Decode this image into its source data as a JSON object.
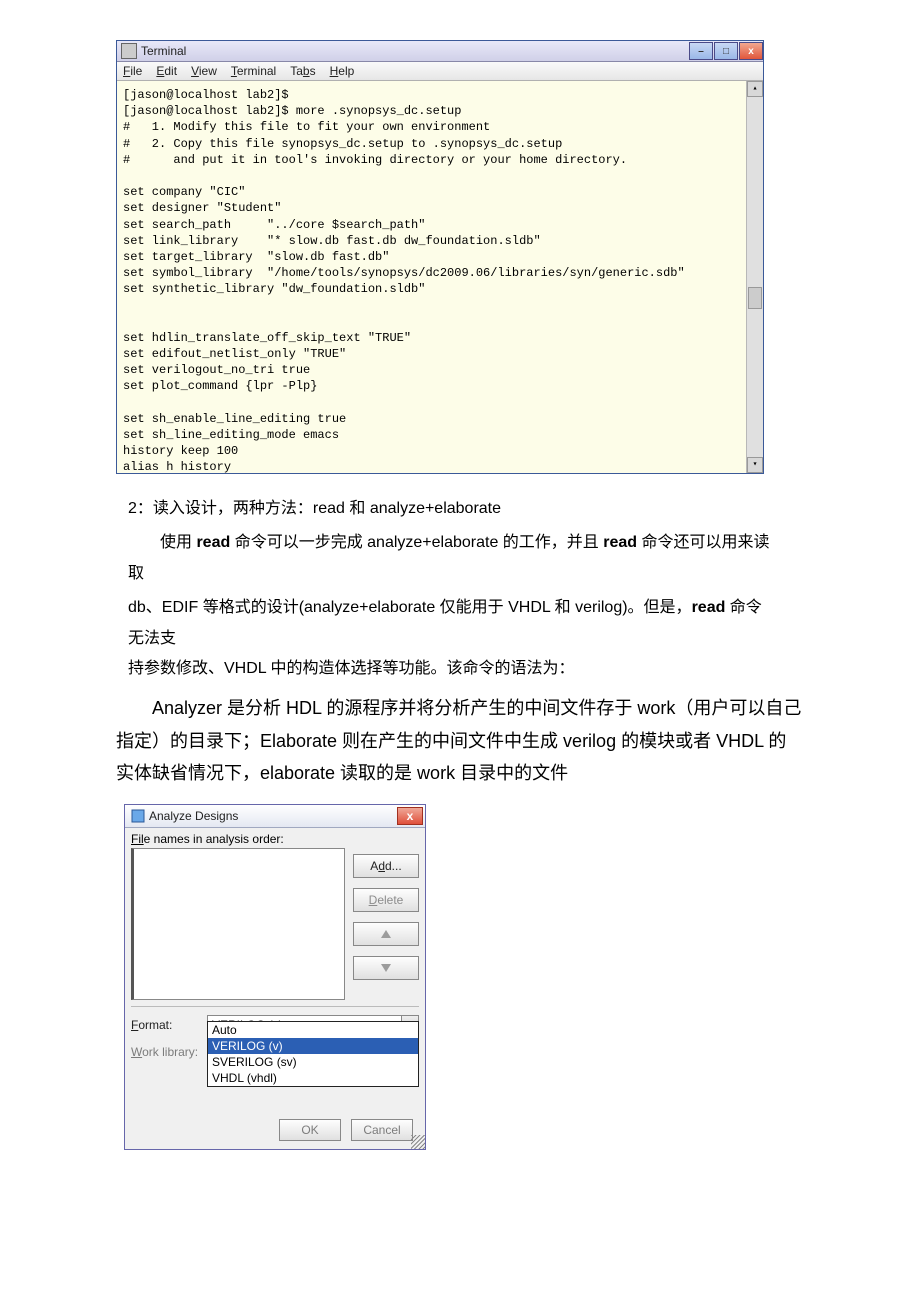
{
  "terminal": {
    "title": "Terminal",
    "menu": {
      "file": "File",
      "edit": "Edit",
      "view": "View",
      "terminal": "Terminal",
      "tabs": "Tabs",
      "help": "Help"
    },
    "content": "[jason@localhost lab2]$\n[jason@localhost lab2]$ more .synopsys_dc.setup\n#   1. Modify this file to fit your own environment\n#   2. Copy this file synopsys_dc.setup to .synopsys_dc.setup\n#      and put it in tool's invoking directory or your home directory.\n\nset company \"CIC\"\nset designer \"Student\"\nset search_path     \"../core $search_path\"\nset link_library    \"* slow.db fast.db dw_foundation.sldb\"\nset target_library  \"slow.db fast.db\"\nset symbol_library  \"/home/tools/synopsys/dc2009.06/libraries/syn/generic.sdb\"\nset synthetic_library \"dw_foundation.sldb\"\n\n\nset hdlin_translate_off_skip_text \"TRUE\"\nset edifout_netlist_only \"TRUE\"\nset verilogout_no_tri true\nset plot_command {lpr -Plp}\n\nset sh_enable_line_editing true\nset sh_line_editing_mode emacs\nhistory keep 100\nalias h history"
  },
  "doc": {
    "heading": "2：读入设计，两种方法：read 和 analyze+elaborate",
    "p1_a": "使用 ",
    "p1_b": "read",
    "p1_c": " 命令可以一步完成 analyze+elaborate 的工作，并且 ",
    "p1_d": "read",
    "p1_e": " 命令还可以用来读取",
    "p2_a": "db、EDIF 等格式的设计(analyze+elaborate 仅能用于 VHDL 和 verilog)。但是，",
    "p2_b": "read",
    "p2_c": " 命令无法支",
    "p3": "持参数修改、VHDL 中的构造体选择等功能。该命令的语法为：",
    "p4": "Analyzer 是分析 HDL 的源程序并将分析产生的中间文件存于 work（用户可以自己指定）的目录下；Elaborate 则在产生的中间文件中生成 verilog 的模块或者 VHDL 的实体缺省情况下，elaborate 读取的是 work 目录中的文件"
  },
  "dialog": {
    "title": "Analyze Designs",
    "list_label": "File names in analysis order:",
    "btn_add": "Add...",
    "btn_delete": "Delete",
    "label_format": "Format:",
    "label_worklib": "Work library:",
    "format_value": "VERILOG (v)",
    "options": {
      "o1": "Auto",
      "o2": "VERILOG (v)",
      "o3": "SVERILOG (sv)",
      "o4": "VHDL (vhdl)"
    },
    "btn_ok": "OK",
    "btn_cancel": "Cancel"
  }
}
